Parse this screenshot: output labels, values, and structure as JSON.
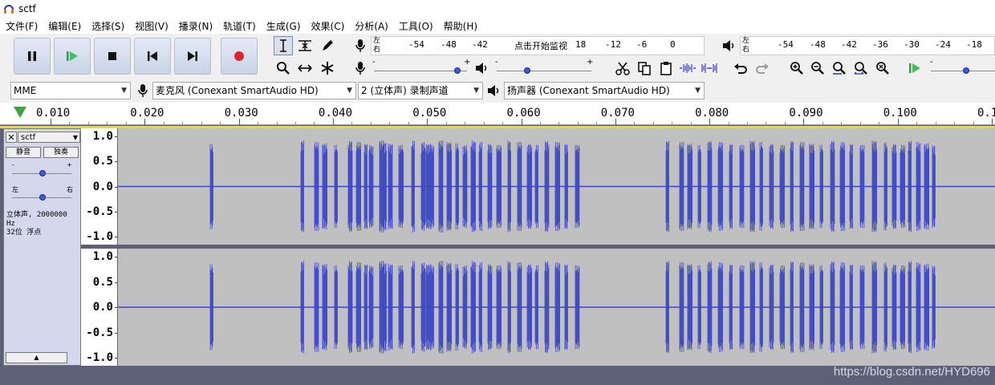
{
  "window": {
    "title": "sctf"
  },
  "menu": [
    "文件(F)",
    "编辑(E)",
    "选择(S)",
    "视图(V)",
    "播录(N)",
    "轨道(T)",
    "生成(G)",
    "效果(C)",
    "分析(A)",
    "工具(O)",
    "帮助(H)"
  ],
  "transport": {
    "pause": "pause-icon",
    "play": "play-icon",
    "stop": "stop-icon",
    "skip_start": "skip-to-start-icon",
    "skip_end": "skip-to-end-icon",
    "record": "record-icon",
    "record_color": "#e0242c"
  },
  "meters": {
    "record": {
      "left_label": "左",
      "right_label": "右",
      "ticks": [
        "-54",
        "-48",
        "-42",
        "18",
        "-12",
        "-6",
        "0"
      ],
      "hint": "点击开始监视"
    },
    "play": {
      "left_label": "左",
      "right_label": "右",
      "ticks": [
        "-54",
        "-48",
        "-42",
        "-36",
        "-30",
        "-24",
        "-18"
      ]
    },
    "slider_minus": "-",
    "slider_plus": "+"
  },
  "devices": {
    "host": "MME",
    "mic": "麦克风 (Conexant SmartAudio HD)",
    "channels": "2 (立体声) 录制声道",
    "speaker": "扬声器 (Conexant SmartAudio HD)"
  },
  "ruler": {
    "labels": [
      "0.010",
      "0.020",
      "0.030",
      "0.040",
      "0.050",
      "0.060",
      "0.070",
      "0.080",
      "0.090",
      "0.100",
      "0.1"
    ]
  },
  "track": {
    "name": "sctf",
    "mute": "静音",
    "solo": "独奏",
    "gain_minus": "-",
    "gain_plus": "+",
    "pan_left": "左",
    "pan_right": "右",
    "info_line1": "立体声, 2000000 Hz",
    "info_line2": "32位 浮点",
    "collapse": "▲",
    "wave_color": "#3c46c8",
    "channels": [
      {
        "scale": [
          "1.0",
          "0.5",
          "0.0",
          "-0.5",
          "-1.0"
        ]
      },
      {
        "scale": [
          "1.0",
          "0.5",
          "0.0",
          "-0.5",
          "-1.0"
        ]
      }
    ]
  },
  "watermark": "https://blog.csdn.net/HYD696"
}
